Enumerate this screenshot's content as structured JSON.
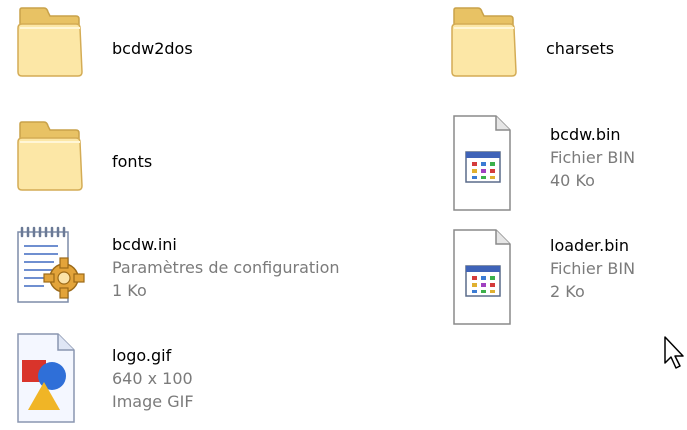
{
  "colors": {
    "background": "#ffffff",
    "name_text": "#000000",
    "meta_text": "#7b7b7b",
    "folder_yellow": "#f4d77a"
  },
  "items": [
    {
      "name": "bcdw2dos",
      "icon": "folder-icon"
    },
    {
      "name": "charsets",
      "icon": "folder-icon"
    },
    {
      "name": "fonts",
      "icon": "folder-icon"
    },
    {
      "name": "bcdw.bin",
      "type": "Fichier BIN",
      "size": "40 Ko",
      "icon": "bin-file-icon"
    },
    {
      "name": "bcdw.ini",
      "type": "Paramètres de configuration",
      "size": "1 Ko",
      "icon": "config-file-icon"
    },
    {
      "name": "loader.bin",
      "type": "Fichier BIN",
      "size": "2 Ko",
      "icon": "bin-file-icon"
    },
    {
      "name": "logo.gif",
      "dimensions": "640 x 100",
      "type": "Image GIF",
      "icon": "image-file-icon"
    }
  ],
  "cursor": {
    "icon": "mouse-pointer-icon"
  }
}
